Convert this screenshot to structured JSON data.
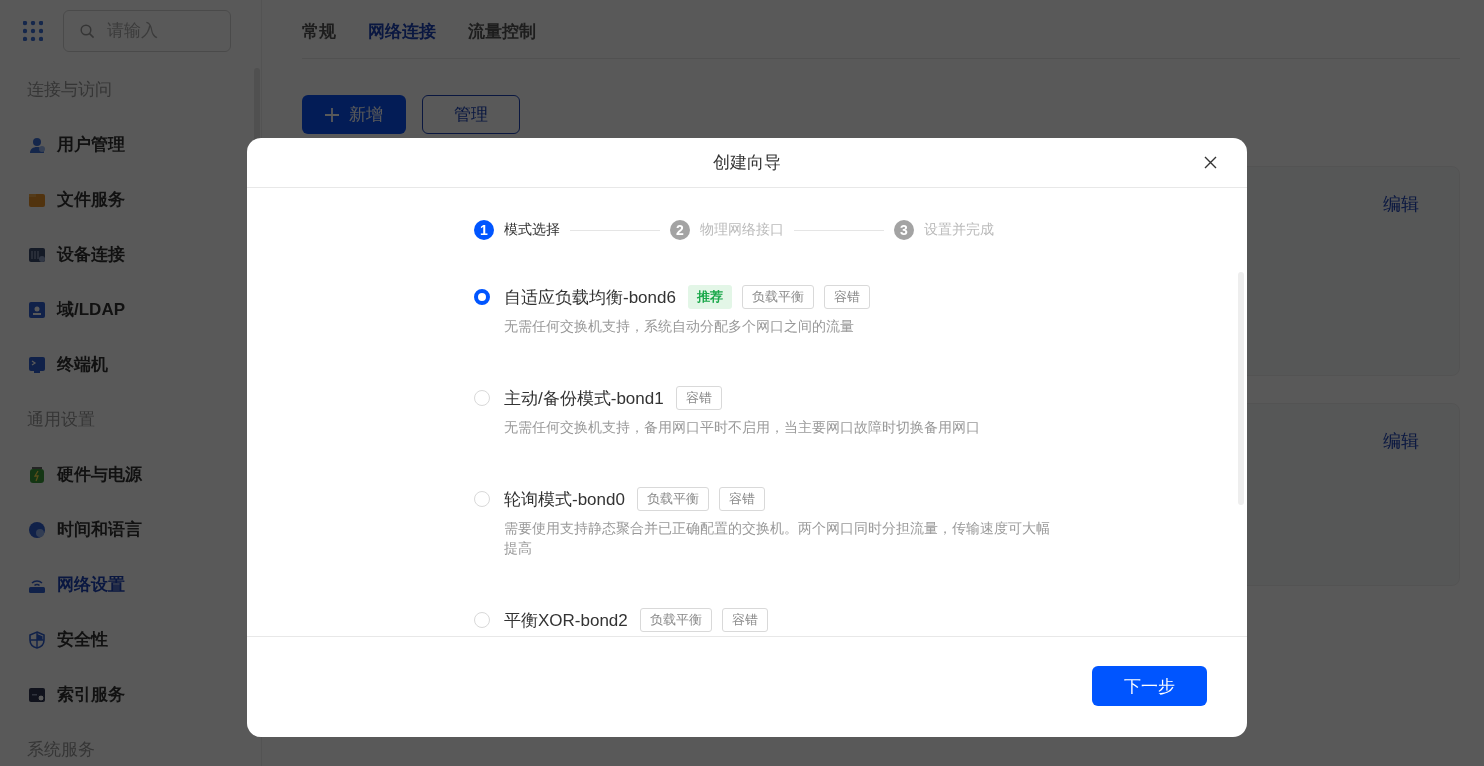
{
  "sidebar": {
    "search": {
      "placeholder": "请输入"
    },
    "sections": [
      {
        "title": "连接与访问",
        "items": [
          {
            "label": "用户管理",
            "kind": "user",
            "selected": false
          },
          {
            "label": "文件服务",
            "kind": "folder",
            "selected": false
          },
          {
            "label": "设备连接",
            "kind": "device",
            "selected": false
          },
          {
            "label": "域/LDAP",
            "kind": "card",
            "selected": false
          },
          {
            "label": "终端机",
            "kind": "terminal",
            "selected": false
          }
        ]
      },
      {
        "title": "通用设置",
        "items": [
          {
            "label": "硬件与电源",
            "kind": "battery",
            "selected": false
          },
          {
            "label": "时间和语言",
            "kind": "globe",
            "selected": false
          },
          {
            "label": "网络设置",
            "kind": "router",
            "selected": true
          },
          {
            "label": "安全性",
            "kind": "shield",
            "selected": false
          },
          {
            "label": "索引服务",
            "kind": "drive",
            "selected": false
          }
        ]
      },
      {
        "title": "系统服务"
      }
    ]
  },
  "tabs": [
    {
      "label": "常规",
      "selected": false
    },
    {
      "label": "网络连接",
      "selected": true
    },
    {
      "label": "流量控制",
      "selected": false
    }
  ],
  "toolbar": {
    "buttons": [
      {
        "label": "新增",
        "kind": "primary"
      },
      {
        "label": "管理",
        "kind": "outline"
      }
    ]
  },
  "cards": [
    {
      "action": "编辑"
    },
    {
      "action": "编辑"
    }
  ],
  "dialog": {
    "title": "创建向导",
    "steps": [
      {
        "number": "1",
        "label": "模式选择",
        "selected": true
      },
      {
        "number": "2",
        "label": "物理网络接口",
        "selected": false
      },
      {
        "number": "3",
        "label": "设置并完成",
        "selected": false
      }
    ],
    "options": [
      {
        "title": "自适应负载均衡-bond6",
        "selected": true,
        "tags": [
          {
            "label": "推荐",
            "kind": "recommended"
          },
          {
            "label": "负载平衡",
            "kind": "plain"
          },
          {
            "label": "容错",
            "kind": "plain"
          }
        ],
        "description": "无需任何交换机支持，系统自动分配多个网口之间的流量"
      },
      {
        "title": "主动/备份模式-bond1",
        "selected": false,
        "tags": [
          {
            "label": "容错",
            "kind": "plain"
          }
        ],
        "description": "无需任何交换机支持，备用网口平时不启用，当主要网口故障时切换备用网口"
      },
      {
        "title": "轮询模式-bond0",
        "selected": false,
        "tags": [
          {
            "label": "负载平衡",
            "kind": "plain"
          },
          {
            "label": "容错",
            "kind": "plain"
          }
        ],
        "description": "需要使用支持静态聚合并已正确配置的交换机。两个网口同时分担流量，传输速度可大幅提高"
      },
      {
        "title": "平衡XOR-bond2",
        "selected": false,
        "tags": [
          {
            "label": "负载平衡",
            "kind": "plain"
          },
          {
            "label": "容错",
            "kind": "plain"
          }
        ]
      }
    ],
    "next_button": "下一步"
  }
}
